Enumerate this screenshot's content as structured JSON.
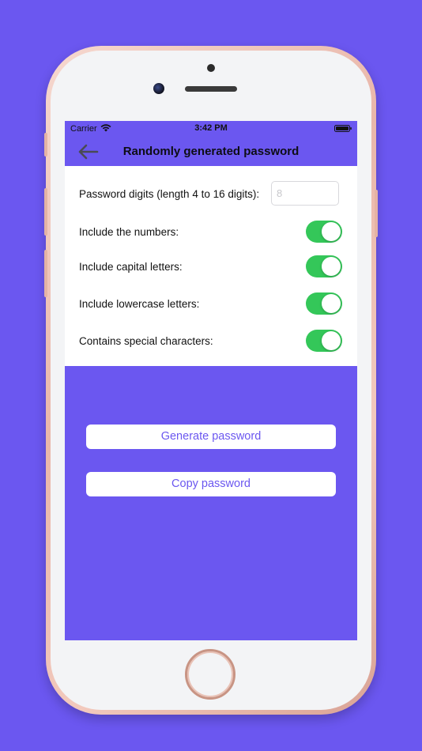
{
  "status_bar": {
    "carrier": "Carrier",
    "time": "3:42 PM"
  },
  "nav": {
    "title": "Randomly generated password",
    "back_icon": "arrow-left-icon"
  },
  "settings": {
    "digits_label": "Password digits (length 4 to 16 digits):",
    "digits_placeholder": "8",
    "options": [
      {
        "label": "Include the numbers:",
        "enabled": true
      },
      {
        "label": "Include capital letters:",
        "enabled": true
      },
      {
        "label": "Include lowercase letters:",
        "enabled": true
      },
      {
        "label": "Contains special characters:",
        "enabled": true
      }
    ]
  },
  "actions": {
    "generate_label": "Generate password",
    "copy_label": "Copy password"
  },
  "colors": {
    "accent": "#6B57F0",
    "toggle_on": "#34C759"
  }
}
